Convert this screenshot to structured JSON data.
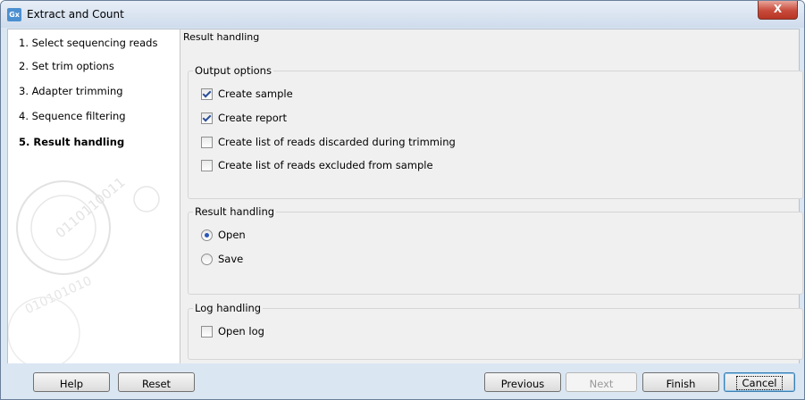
{
  "window": {
    "app_icon": "Gx",
    "title": "Extract and Count",
    "close_icon": "X"
  },
  "steps": [
    {
      "label": "1.  Select sequencing reads"
    },
    {
      "label": "2.  Set trim options"
    },
    {
      "label": "3.  Adapter trimming"
    },
    {
      "label": "4.  Sequence filtering"
    },
    {
      "label": "5.  Result handling"
    }
  ],
  "active_step": 5,
  "main": {
    "title": "Result handling",
    "output_options": {
      "legend": "Output options",
      "items": [
        {
          "label": "Create sample",
          "checked": true
        },
        {
          "label": "Create report",
          "checked": true
        },
        {
          "label": "Create list of reads discarded during trimming",
          "checked": false
        },
        {
          "label": "Create list of reads excluded from sample",
          "checked": false
        }
      ]
    },
    "result_handling": {
      "legend": "Result handling",
      "items": [
        {
          "label": "Open",
          "selected": true
        },
        {
          "label": "Save",
          "selected": false
        }
      ]
    },
    "log_handling": {
      "legend": "Log handling",
      "items": [
        {
          "label": "Open log",
          "checked": false
        }
      ]
    }
  },
  "buttons": {
    "help": "Help",
    "reset": "Reset",
    "previous": "Previous",
    "next": "Next",
    "finish": "Finish",
    "cancel": "Cancel"
  }
}
